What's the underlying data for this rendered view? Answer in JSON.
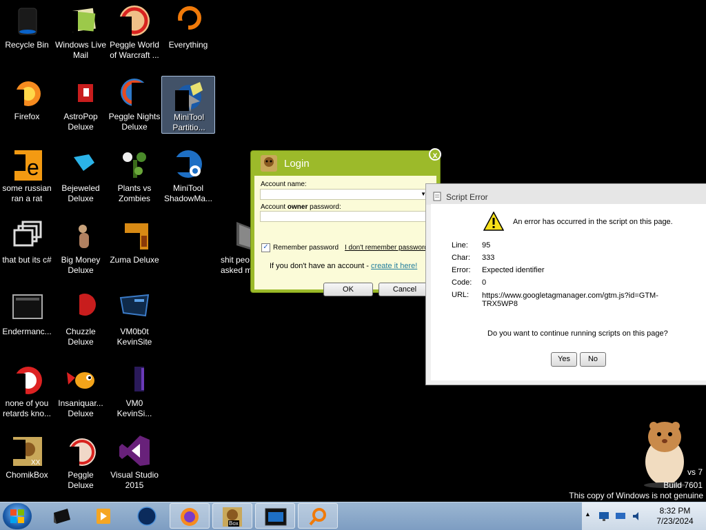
{
  "desktop_icons": [
    {
      "label": "Recycle Bin",
      "icon": "recycle-bin-icon"
    },
    {
      "label": "Windows Live\nMail",
      "icon": "mail-icon"
    },
    {
      "label": "Peggle World\nof Warcraft ...",
      "icon": "peggle-icon"
    },
    {
      "label": "Everything",
      "icon": "search-icon"
    },
    {
      "label": "Firefox",
      "icon": "firefox-icon"
    },
    {
      "label": "AstroPop\nDeluxe",
      "icon": "game-icon"
    },
    {
      "label": "Peggle Nights\nDeluxe",
      "icon": "peggle-icon"
    },
    {
      "label": "MiniTool\nPartitio...",
      "icon": "minitool-icon"
    },
    {
      "label": "some russian\nran a rat",
      "icon": "app-icon"
    },
    {
      "label": "Bejeweled\nDeluxe",
      "icon": "gem-icon"
    },
    {
      "label": "Plants vs\nZombies",
      "icon": "plant-icon"
    },
    {
      "label": "MiniTool\nShadowMa...",
      "icon": "minitool-icon"
    },
    {
      "label": "that but its c#",
      "icon": "window-icon"
    },
    {
      "label": "Big Money\nDeluxe",
      "icon": "game-icon"
    },
    {
      "label": "Zuma Deluxe",
      "icon": "zuma-icon"
    },
    {
      "label": "shit peo\nasked m",
      "icon": "folder-icon"
    },
    {
      "label": "Endermanc...",
      "icon": "window-icon"
    },
    {
      "label": "Chuzzle\nDeluxe",
      "icon": "game-icon"
    },
    {
      "label": "VM0b0t\nKevinSite",
      "icon": "vm-icon"
    },
    {
      "label": "none of you\nretards kno...",
      "icon": "app-icon"
    },
    {
      "label": "Insaniquar...\nDeluxe",
      "icon": "fish-icon"
    },
    {
      "label": "VM0\nKevinSi...",
      "icon": "vm-icon"
    },
    {
      "label": "ChomikBox",
      "icon": "hamster-icon"
    },
    {
      "label": "Peggle Deluxe",
      "icon": "peggle-icon"
    },
    {
      "label": "Visual Studio\n2015",
      "icon": "visual-studio-icon"
    }
  ],
  "login": {
    "title": "Login",
    "account_name_label": "Account name:",
    "password_label_pre": "Account ",
    "password_label_bold": "owner",
    "password_label_post": " password:",
    "remember_label": "Remember password",
    "remember_checked": true,
    "forgot_link": "I don't remember password",
    "no_account_text": "If you don't have an account - ",
    "create_link": "create it here!",
    "ok_label": "OK",
    "cancel_label": "Cancel",
    "close_glyph": "x"
  },
  "script_error": {
    "title": "Script Error",
    "message": "An error has occurred in the script on this page.",
    "rows": [
      {
        "label": "Line:",
        "value": "95"
      },
      {
        "label": "Char:",
        "value": "333"
      },
      {
        "label": "Error:",
        "value": "Expected identifier"
      },
      {
        "label": "Code:",
        "value": "0"
      },
      {
        "label": "URL:",
        "value": "https://www.googletagmanager.com/gtm.js?id=GTM-\nTRX5WP8"
      }
    ],
    "question": "Do you want to continue running scripts on this page?",
    "yes_label": "Yes",
    "no_label": "No"
  },
  "watermark": {
    "line1": "vs 7",
    "line2": "Build 7601",
    "line3": "This copy of Windows is not genuine"
  },
  "taskbar": {
    "pinned": [
      {
        "name": "taskbar-app-1",
        "icon": "box-icon"
      },
      {
        "name": "taskbar-media-player",
        "icon": "media-player-icon"
      },
      {
        "name": "taskbar-globe",
        "icon": "globe-icon"
      },
      {
        "name": "taskbar-firefox",
        "icon": "firefox-icon"
      },
      {
        "name": "taskbar-chomikbox",
        "icon": "hamster-icon"
      },
      {
        "name": "taskbar-window",
        "icon": "window-icon"
      },
      {
        "name": "taskbar-everything",
        "icon": "search-icon"
      }
    ],
    "time": "8:32 PM",
    "date": "7/23/2024",
    "chomikbox_badge": "Box"
  },
  "colors": {
    "login_green": "#9cba2a",
    "login_body": "#fbfbd8",
    "taskbar": "#8aa8c8",
    "link": "#1f7c9c"
  }
}
